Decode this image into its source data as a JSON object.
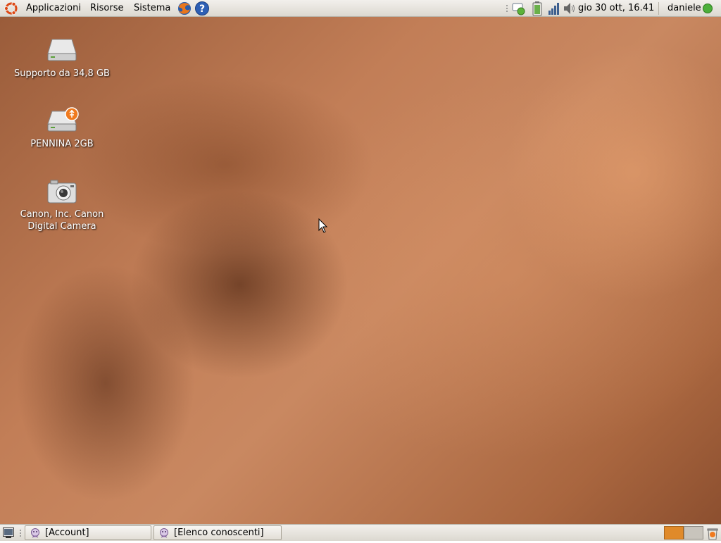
{
  "top_panel": {
    "menus": [
      {
        "label": "Applicazioni"
      },
      {
        "label": "Risorse"
      },
      {
        "label": "Sistema"
      }
    ],
    "clock": "gio 30 ott, 16.41",
    "user": "daniele"
  },
  "desktop": {
    "icons": [
      {
        "label": "Supporto da 34,8 GB",
        "icon": "hard-drive-icon"
      },
      {
        "label": "PENNINA 2GB",
        "icon": "usb-drive-icon"
      },
      {
        "label": "Canon, Inc. Canon Digital Camera",
        "icon": "camera-icon"
      }
    ]
  },
  "taskbar": {
    "windows": [
      {
        "label": "[Account]"
      },
      {
        "label": "[Elenco conoscenti]"
      }
    ]
  },
  "colors": {
    "panel": "#dcd8d0",
    "status_online": "#4caf3a",
    "workspace_active": "#e08a2a"
  }
}
